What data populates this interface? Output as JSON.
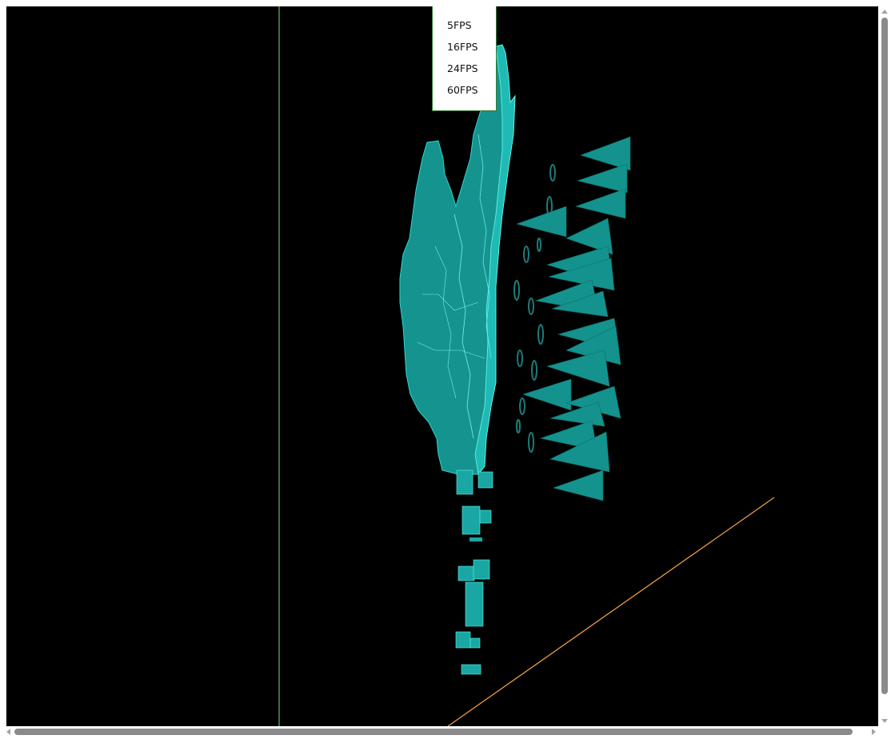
{
  "fps_menu": {
    "options": [
      {
        "label": "5FPS"
      },
      {
        "label": "16FPS"
      },
      {
        "label": "24FPS"
      },
      {
        "label": "60FPS"
      }
    ]
  },
  "scene": {
    "background_color": "#000000",
    "mesh_color": "#1aa7a3",
    "mesh_edge_color": "#5ef2ec",
    "vertical_axis_color": "#7ee07e",
    "diagonal_axis_color": "#e89a3c"
  }
}
